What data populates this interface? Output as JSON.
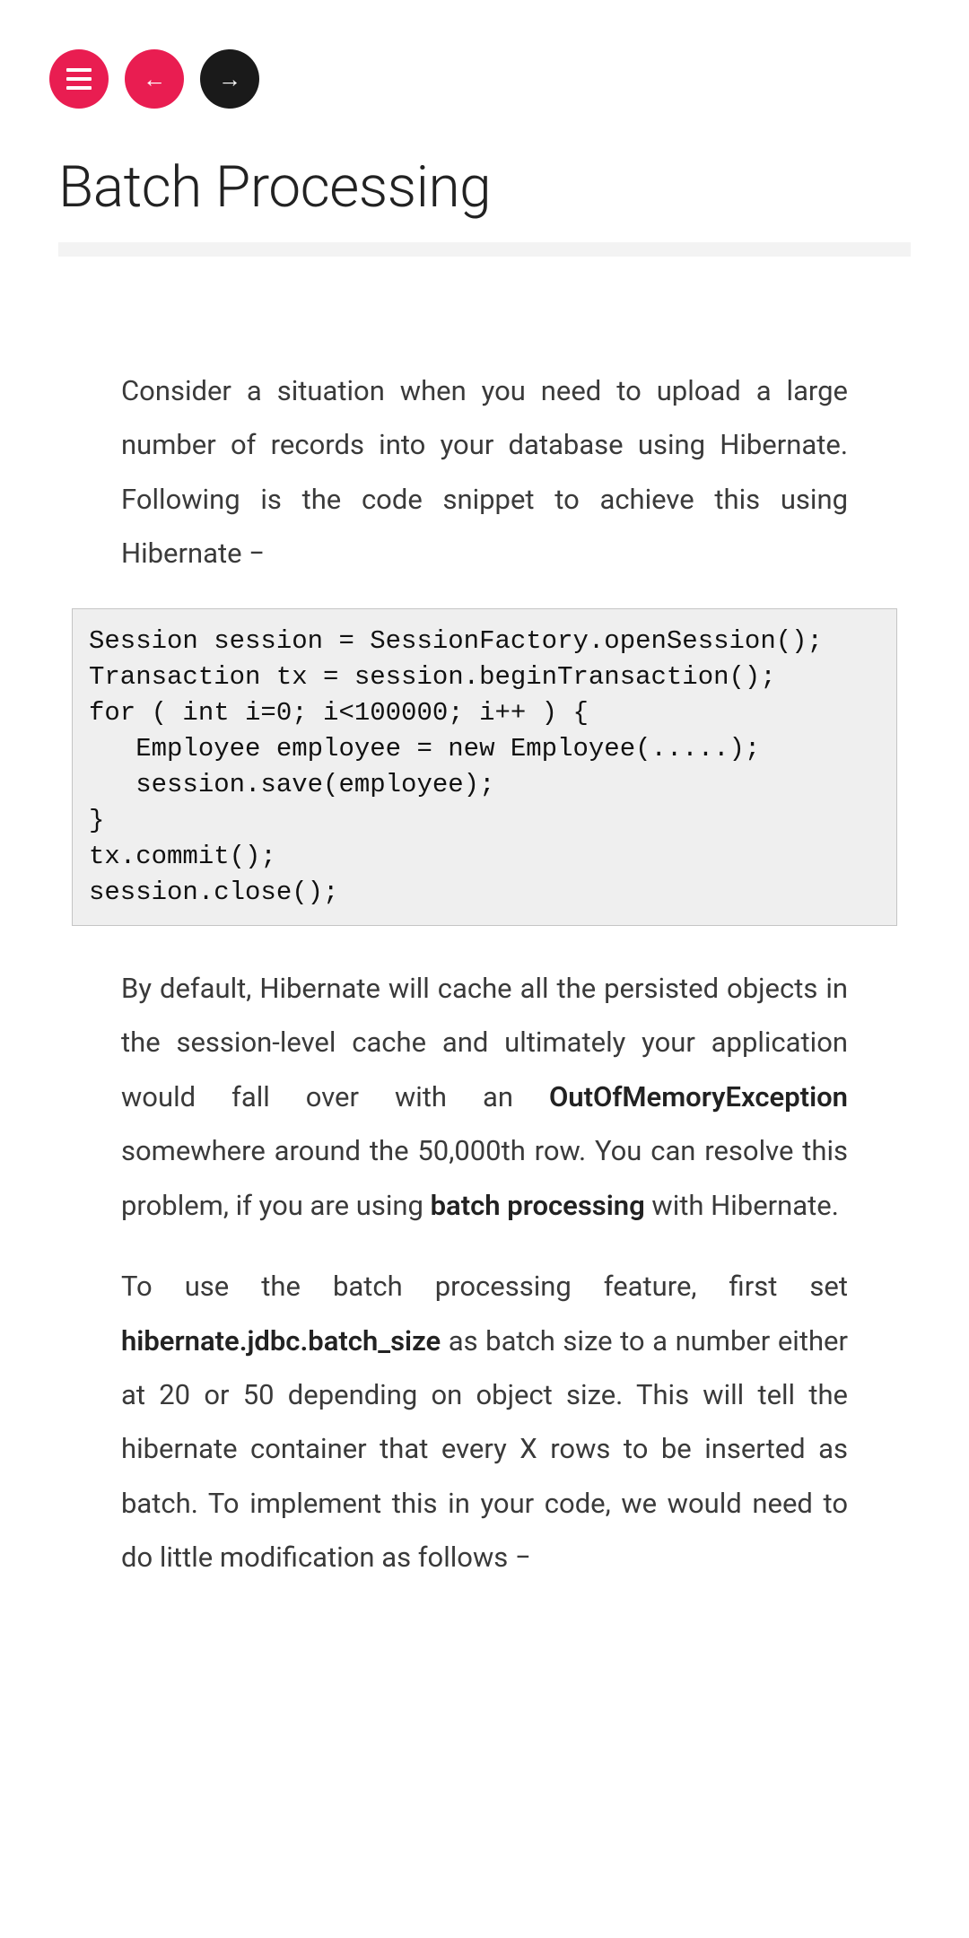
{
  "nav": {
    "menu_label": "menu",
    "prev_label": "←",
    "next_label": "→"
  },
  "page": {
    "title": "Batch Processing"
  },
  "content": {
    "para1": "Consider a situation when you need to upload a large number of records into your database using Hibernate. Following is the code snippet to achieve this using Hibernate −",
    "code1": "Session session = SessionFactory.openSession();\nTransaction tx = session.beginTransaction();\nfor ( int i=0; i<100000; i++ ) {\n   Employee employee = new Employee(.....);\n   session.save(employee);\n}\ntx.commit();\nsession.close();",
    "para2_a": "By default, Hibernate will cache all the persisted objects in the session-level cache and ultimately your application would fall over with an ",
    "para2_bold1": "OutOfMemoryException",
    "para2_b": " somewhere around the 50,000th row. You can resolve this problem, if you are using ",
    "para2_bold2": "batch processing",
    "para2_c": " with Hibernate.",
    "para3_a": "To use the batch processing feature, first set ",
    "para3_bold1": "hibernate.jdbc.batch_size",
    "para3_b": " as batch size to a number either at 20 or 50 depending on object size. This will tell the hibernate container that every X rows to be inserted as batch. To implement this in your code, we would need to do little modification as follows −"
  }
}
